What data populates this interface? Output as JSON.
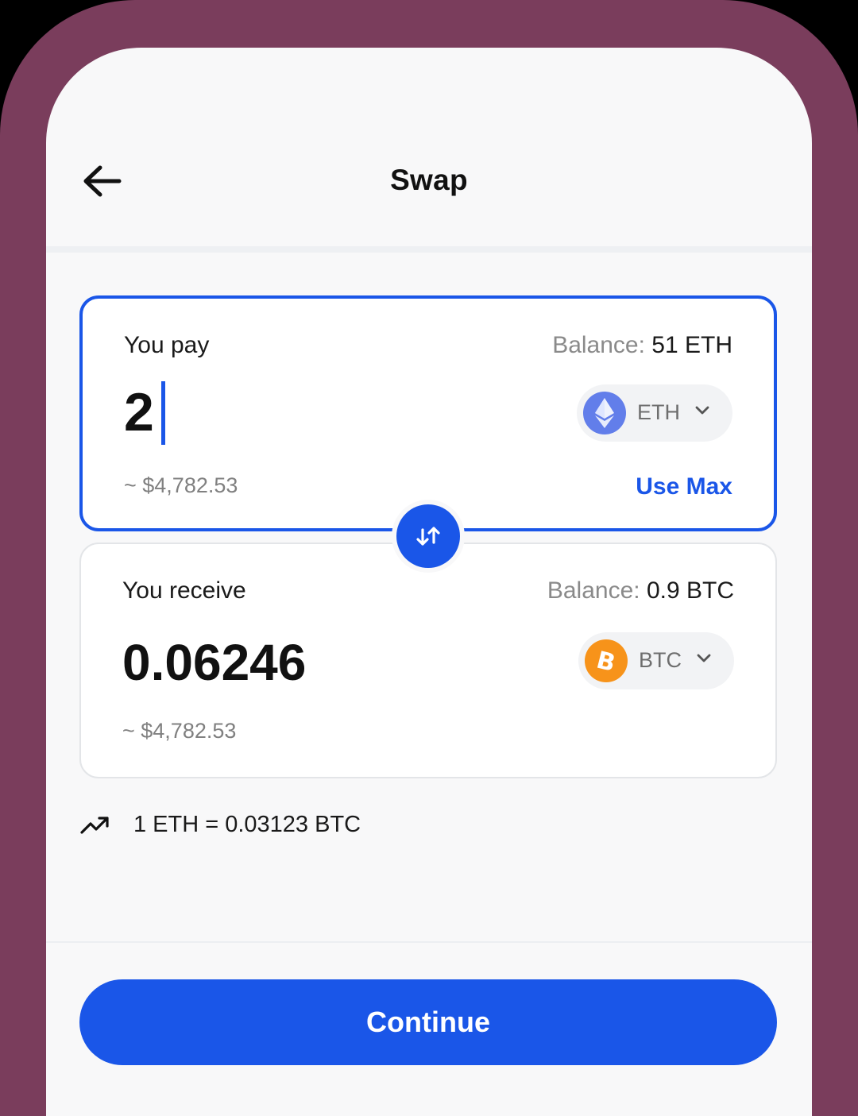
{
  "header": {
    "title": "Swap"
  },
  "pay": {
    "label": "You pay",
    "balance_label": "Balance:",
    "balance_value": "51 ETH",
    "amount": "2",
    "fiat": "~ $4,782.53",
    "token": "ETH",
    "use_max": "Use Max"
  },
  "receive": {
    "label": "You receive",
    "balance_label": "Balance:",
    "balance_value": "0.9 BTC",
    "amount": "0.06246",
    "fiat": "~ $4,782.53",
    "token": "BTC"
  },
  "rate": {
    "text": "1 ETH = 0.03123 BTC"
  },
  "footer": {
    "continue_label": "Continue"
  },
  "colors": {
    "accent": "#1a56e8",
    "frame": "#7a3d5c",
    "eth": "#627eea",
    "btc": "#f7931a"
  },
  "icons": {
    "back": "arrow-left-icon",
    "eth": "ethereum-icon",
    "btc": "bitcoin-icon",
    "swap": "swap-arrows-icon",
    "chevron": "chevron-down-icon",
    "trend": "trending-up-icon"
  }
}
